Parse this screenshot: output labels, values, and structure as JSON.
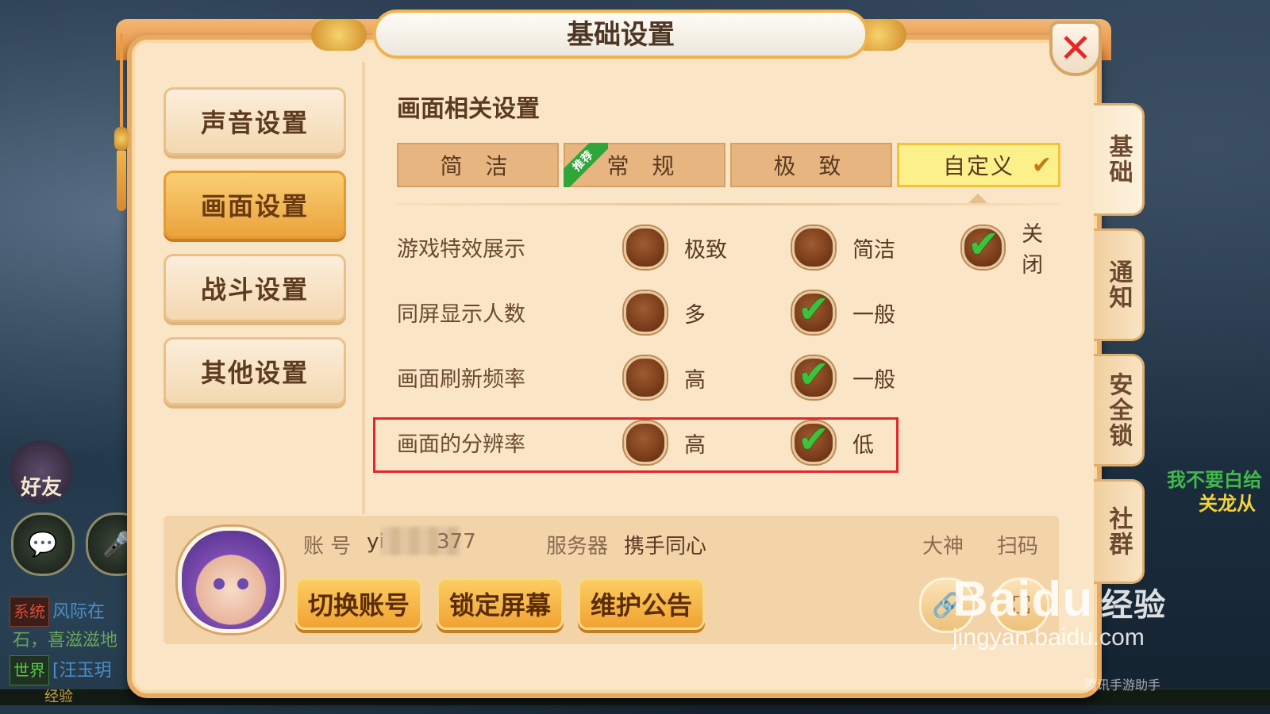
{
  "dialog": {
    "title": "基础设置",
    "close_glyph": "✕"
  },
  "left_menu": [
    {
      "label": "声音设置",
      "active": false
    },
    {
      "label": "画面设置",
      "active": true
    },
    {
      "label": "战斗设置",
      "active": false
    },
    {
      "label": "其他设置",
      "active": false
    }
  ],
  "section_title": "画面相关设置",
  "presets": [
    {
      "label": "简 洁",
      "selected": false
    },
    {
      "label": "常 规",
      "selected": false,
      "ribbon": "推荐"
    },
    {
      "label": "极 致",
      "selected": false
    },
    {
      "label": "自定义",
      "selected": true
    }
  ],
  "settings": [
    {
      "label": "游戏特效展示",
      "options": [
        {
          "label": "极致",
          "checked": false
        },
        {
          "label": "简洁",
          "checked": false
        },
        {
          "label": "关闭",
          "checked": true
        }
      ]
    },
    {
      "label": "同屏显示人数",
      "options": [
        {
          "label": "多",
          "checked": false
        },
        {
          "label": "一般",
          "checked": true
        }
      ]
    },
    {
      "label": "画面刷新频率",
      "options": [
        {
          "label": "高",
          "checked": false
        },
        {
          "label": "一般",
          "checked": true
        }
      ]
    },
    {
      "label": "画面的分辨率",
      "options": [
        {
          "label": "高",
          "checked": false
        },
        {
          "label": "低",
          "checked": true
        }
      ],
      "highlighted": true
    }
  ],
  "account": {
    "account_label": "账 号",
    "account_value": "yi",
    "account_suffix": "377",
    "server_label": "服务器",
    "server_value": "携手同心",
    "dashen_label": "大神",
    "scan_label": "扫码",
    "buttons": [
      "切换账号",
      "锁定屏幕",
      "维护公告"
    ]
  },
  "side_tabs": [
    {
      "label": "基础",
      "active": true
    },
    {
      "label": "通知",
      "active": false
    },
    {
      "label": "安全锁",
      "active": false
    },
    {
      "label": "社群",
      "active": false
    }
  ],
  "background": {
    "friend_label": "好友",
    "chat": [
      {
        "tag": "系统",
        "text": "风际在"
      },
      {
        "tag": "",
        "text": "石，喜滋滋地"
      },
      {
        "tag": "世界",
        "text": "[汪玉玥"
      }
    ],
    "right_text_1": "我不要白给",
    "right_text_2": "关龙从",
    "exp_label": "经验"
  },
  "watermark": {
    "brand": "Baidu",
    "brand_suffix": "经验",
    "url": "jingyan.baidu.com",
    "credit": "腾讯手游助手"
  },
  "colors": {
    "panel_bg": "#fae6c6",
    "accent_orange": "#f0a332",
    "check_green": "#3bc43b",
    "highlight_red": "#e3262b"
  }
}
